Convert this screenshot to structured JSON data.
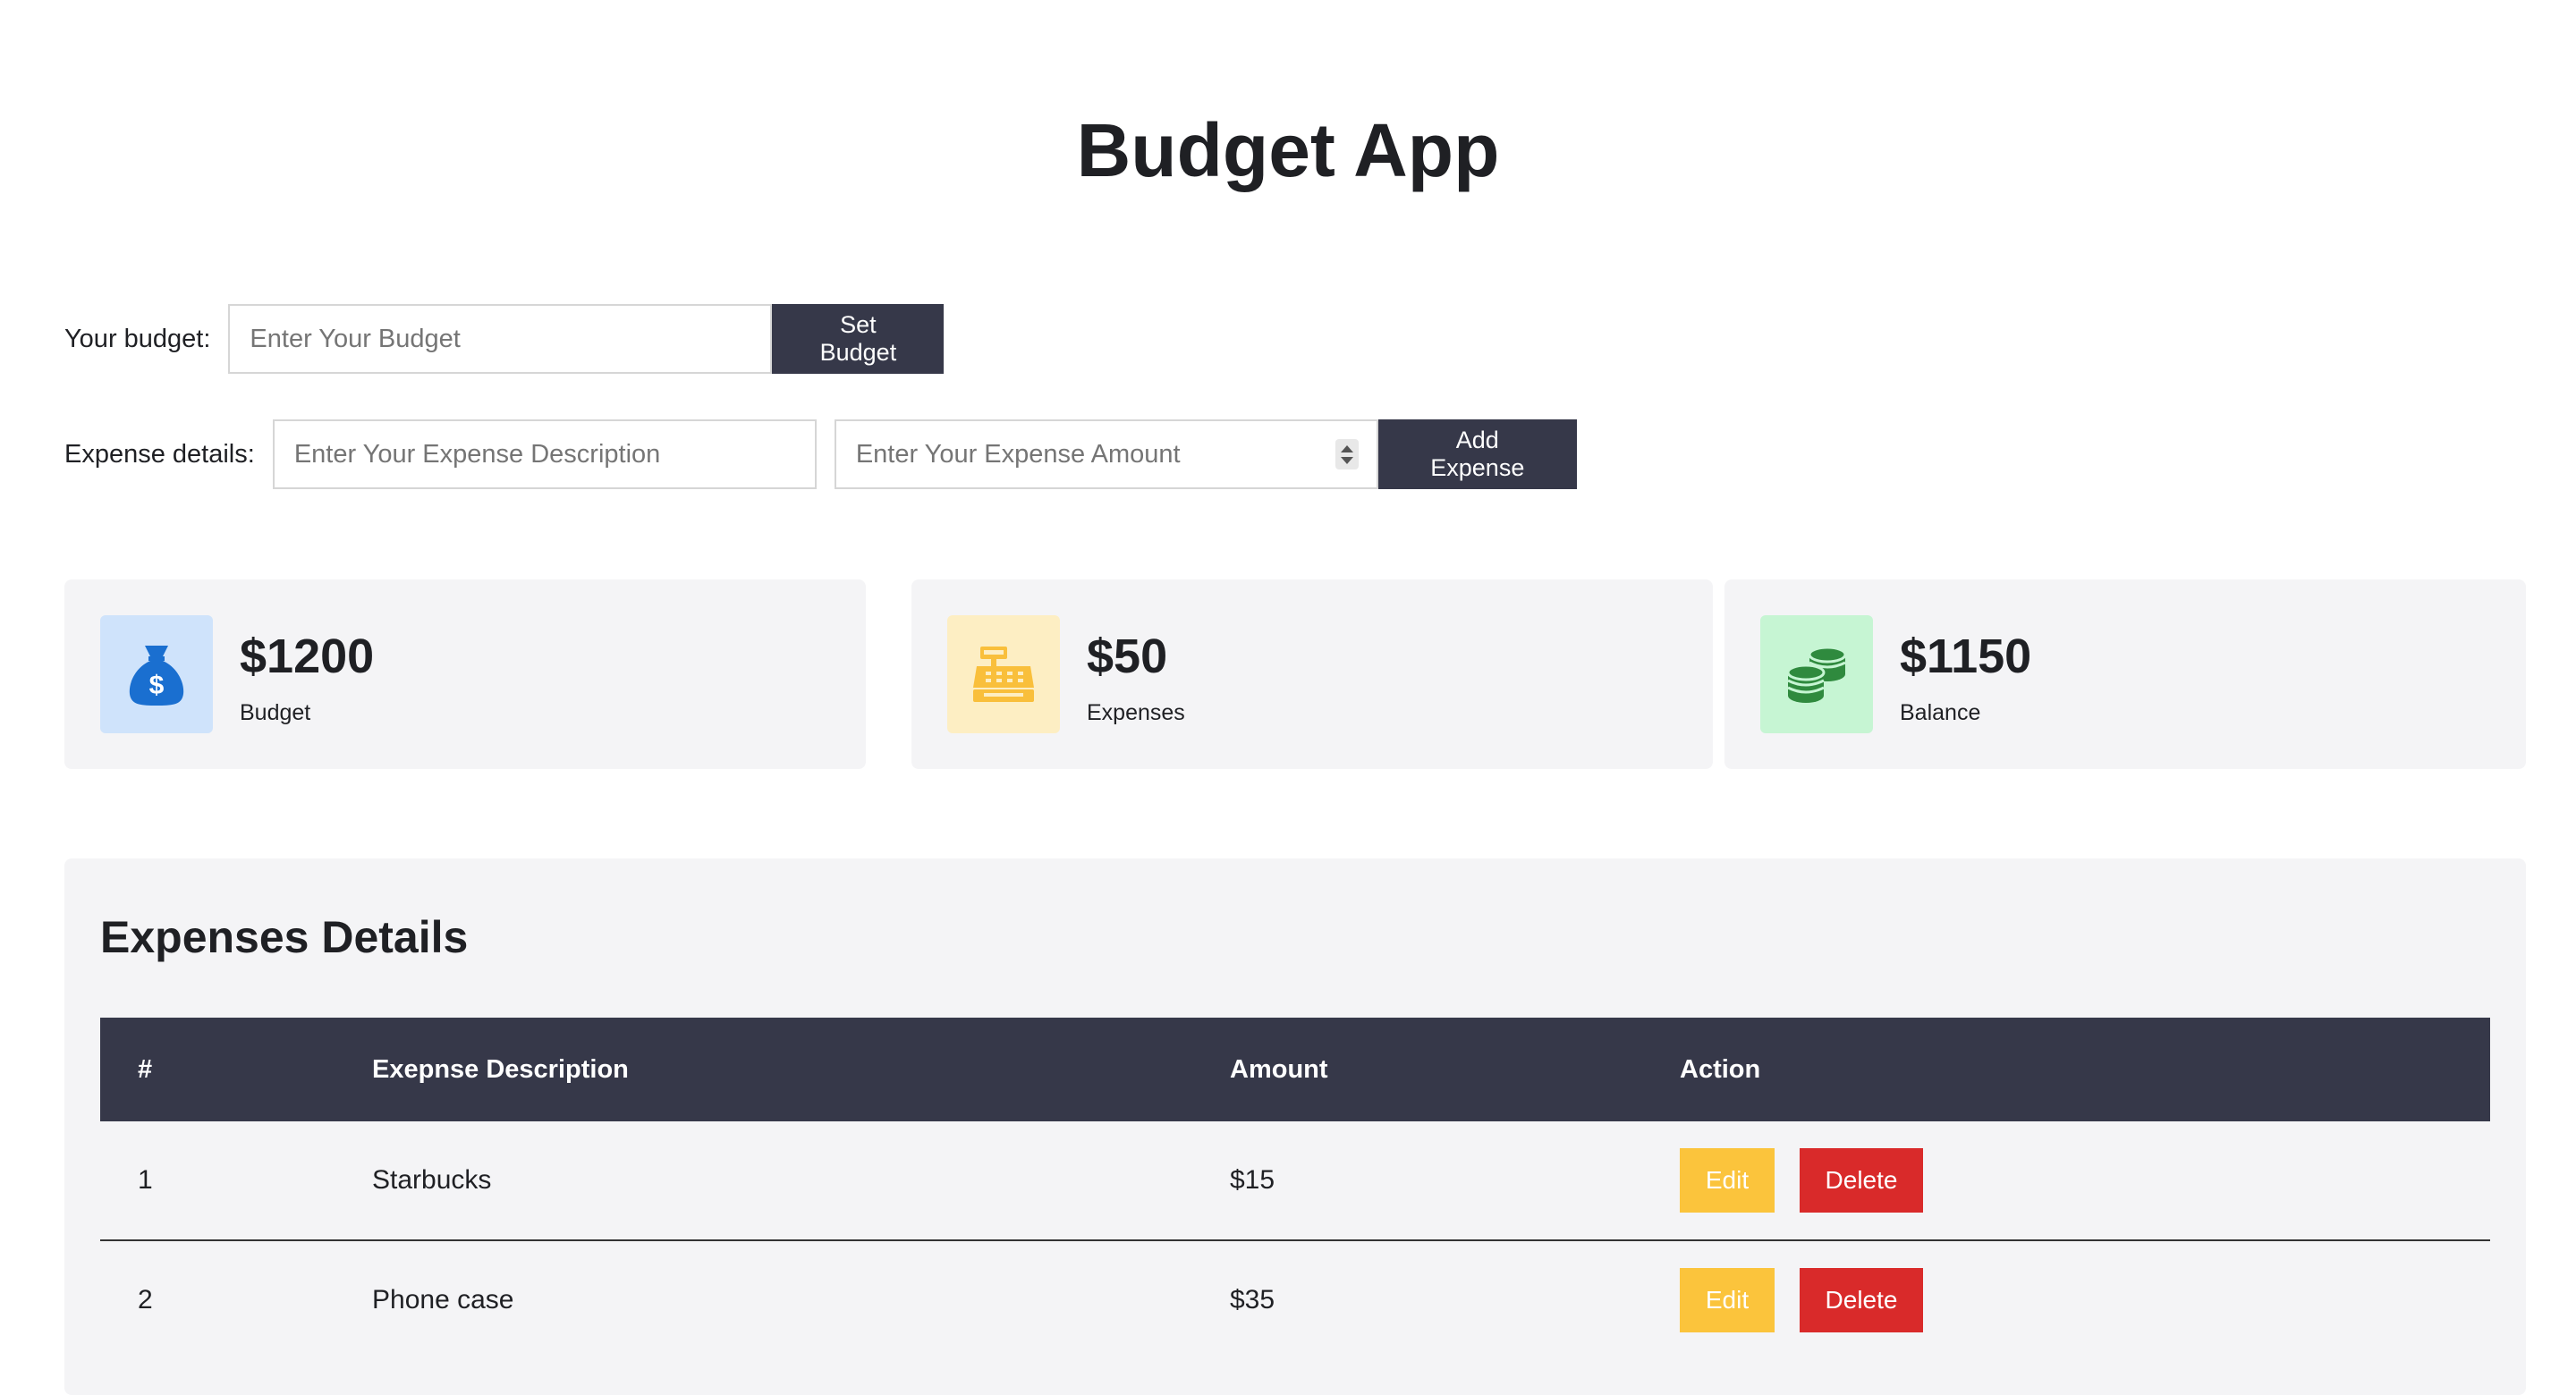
{
  "page": {
    "title": "Budget App"
  },
  "budget_form": {
    "label": "Your budget:",
    "placeholder": "Enter Your Budget",
    "button": "Set Budget"
  },
  "expense_form": {
    "label": "Expense details:",
    "description_placeholder": "Enter Your Expense Description",
    "amount_placeholder": "Enter Your Expense Amount",
    "button": "Add Expense"
  },
  "summary": [
    {
      "value": "$1200",
      "label": "Budget",
      "icon": "money-bag-icon",
      "icon_bg": "#cfe3fb",
      "icon_color": "#1a6fd0"
    },
    {
      "value": "$50",
      "label": "Expenses",
      "icon": "cash-register-icon",
      "icon_bg": "#fdeec3",
      "icon_color": "#f9bf3b"
    },
    {
      "value": "$1150",
      "label": "Balance",
      "icon": "coins-icon",
      "icon_bg": "#c6f5d3",
      "icon_color": "#2f8a3e"
    }
  ],
  "expenses": {
    "title": "Expenses Details",
    "columns": [
      "#",
      "Exepnse Description",
      "Amount",
      "Action"
    ],
    "rows": [
      {
        "num": "1",
        "description": "Starbucks",
        "amount": "$15",
        "edit": "Edit",
        "delete": "Delete"
      },
      {
        "num": "2",
        "description": "Phone case",
        "amount": "$35",
        "edit": "Edit",
        "delete": "Delete"
      }
    ]
  },
  "colors": {
    "dark": "#363849",
    "edit": "#fbc43c",
    "delete": "#d92a2a",
    "panel": "#f4f4f6"
  }
}
